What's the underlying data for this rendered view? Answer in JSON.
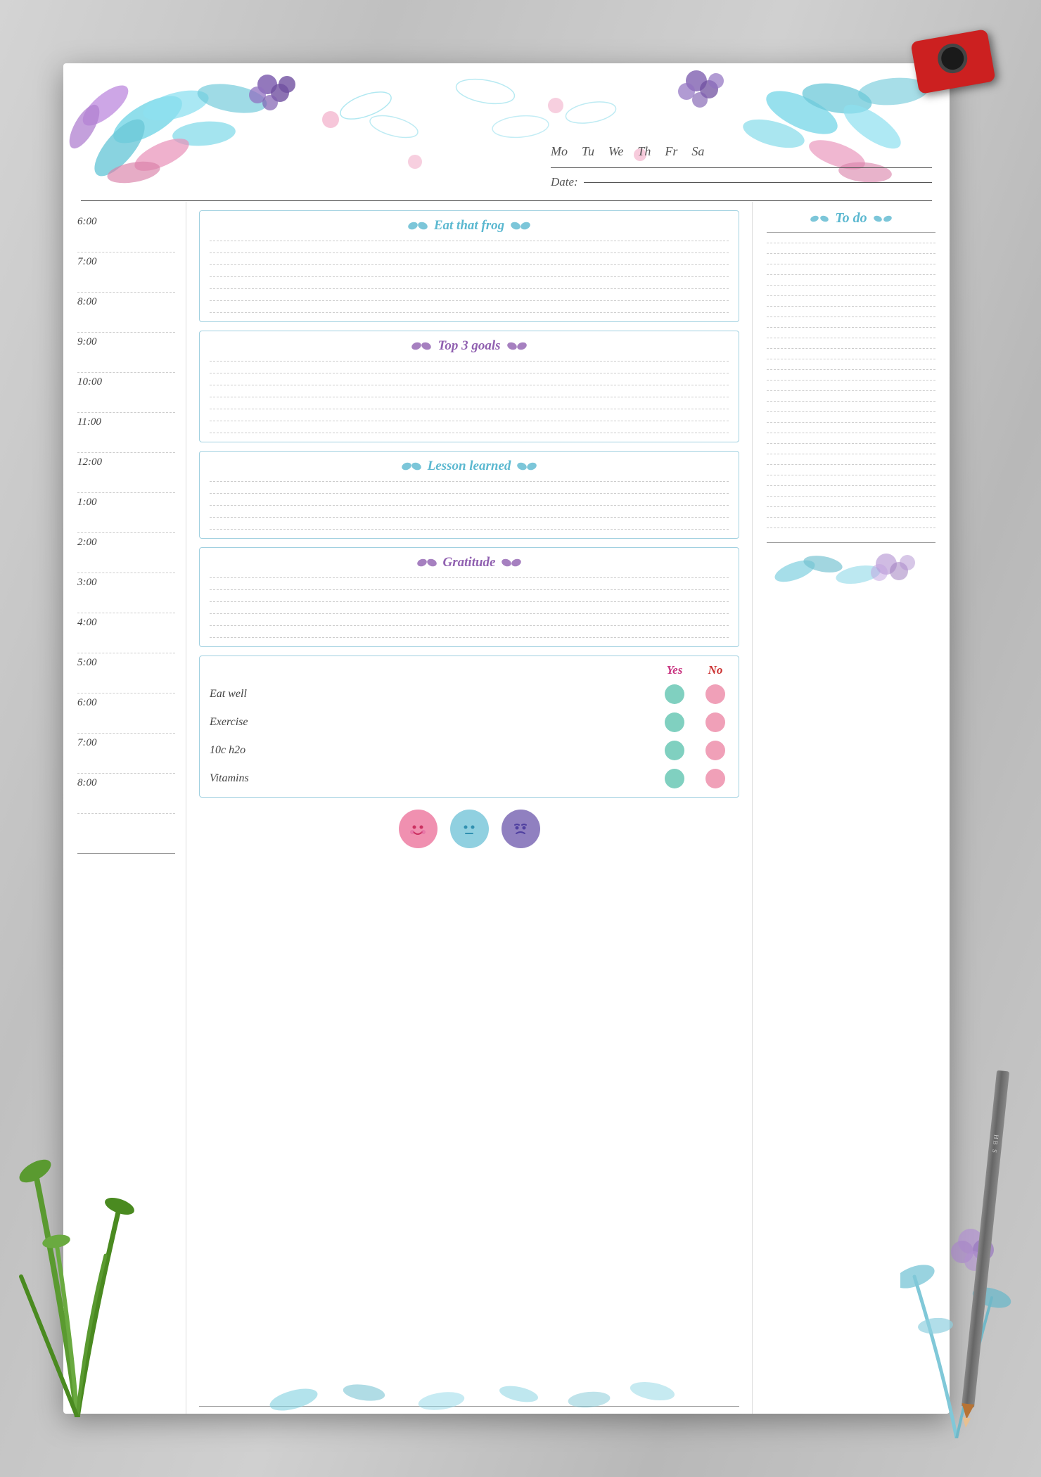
{
  "background": {
    "color": "#c8c8c8"
  },
  "header": {
    "days": [
      "Mo",
      "Tu",
      "We",
      "Th",
      "Fr",
      "Sa"
    ],
    "date_label": "Date:"
  },
  "time_slots": [
    "6:00",
    "7:00",
    "8:00",
    "9:00",
    "10:00",
    "11:00",
    "12:00",
    "1:00",
    "2:00",
    "3:00",
    "4:00",
    "5:00",
    "6:00",
    "7:00",
    "8:00"
  ],
  "sections": {
    "eat_frog": {
      "title": "Eat that frog",
      "lines": 8
    },
    "top3goals": {
      "title": "Top 3 goals",
      "lines": 8
    },
    "lesson_learned": {
      "title": "Lesson learned",
      "lines": 6
    },
    "gratitude": {
      "title": "Gratitude",
      "lines": 7
    }
  },
  "todo": {
    "title": "To do",
    "lines": 28
  },
  "habits": {
    "yes_label": "Yes",
    "no_label": "No",
    "items": [
      {
        "name": "Eat well"
      },
      {
        "name": "Exercise"
      },
      {
        "name": "10c h2o"
      },
      {
        "name": "Vitamins"
      }
    ]
  },
  "moods": [
    {
      "type": "happy",
      "emoji": "😊"
    },
    {
      "type": "neutral",
      "emoji": "😐"
    },
    {
      "type": "sad",
      "emoji": "😠"
    }
  ],
  "leaf_symbols": {
    "teal": "🍃",
    "purple": "🌿"
  }
}
